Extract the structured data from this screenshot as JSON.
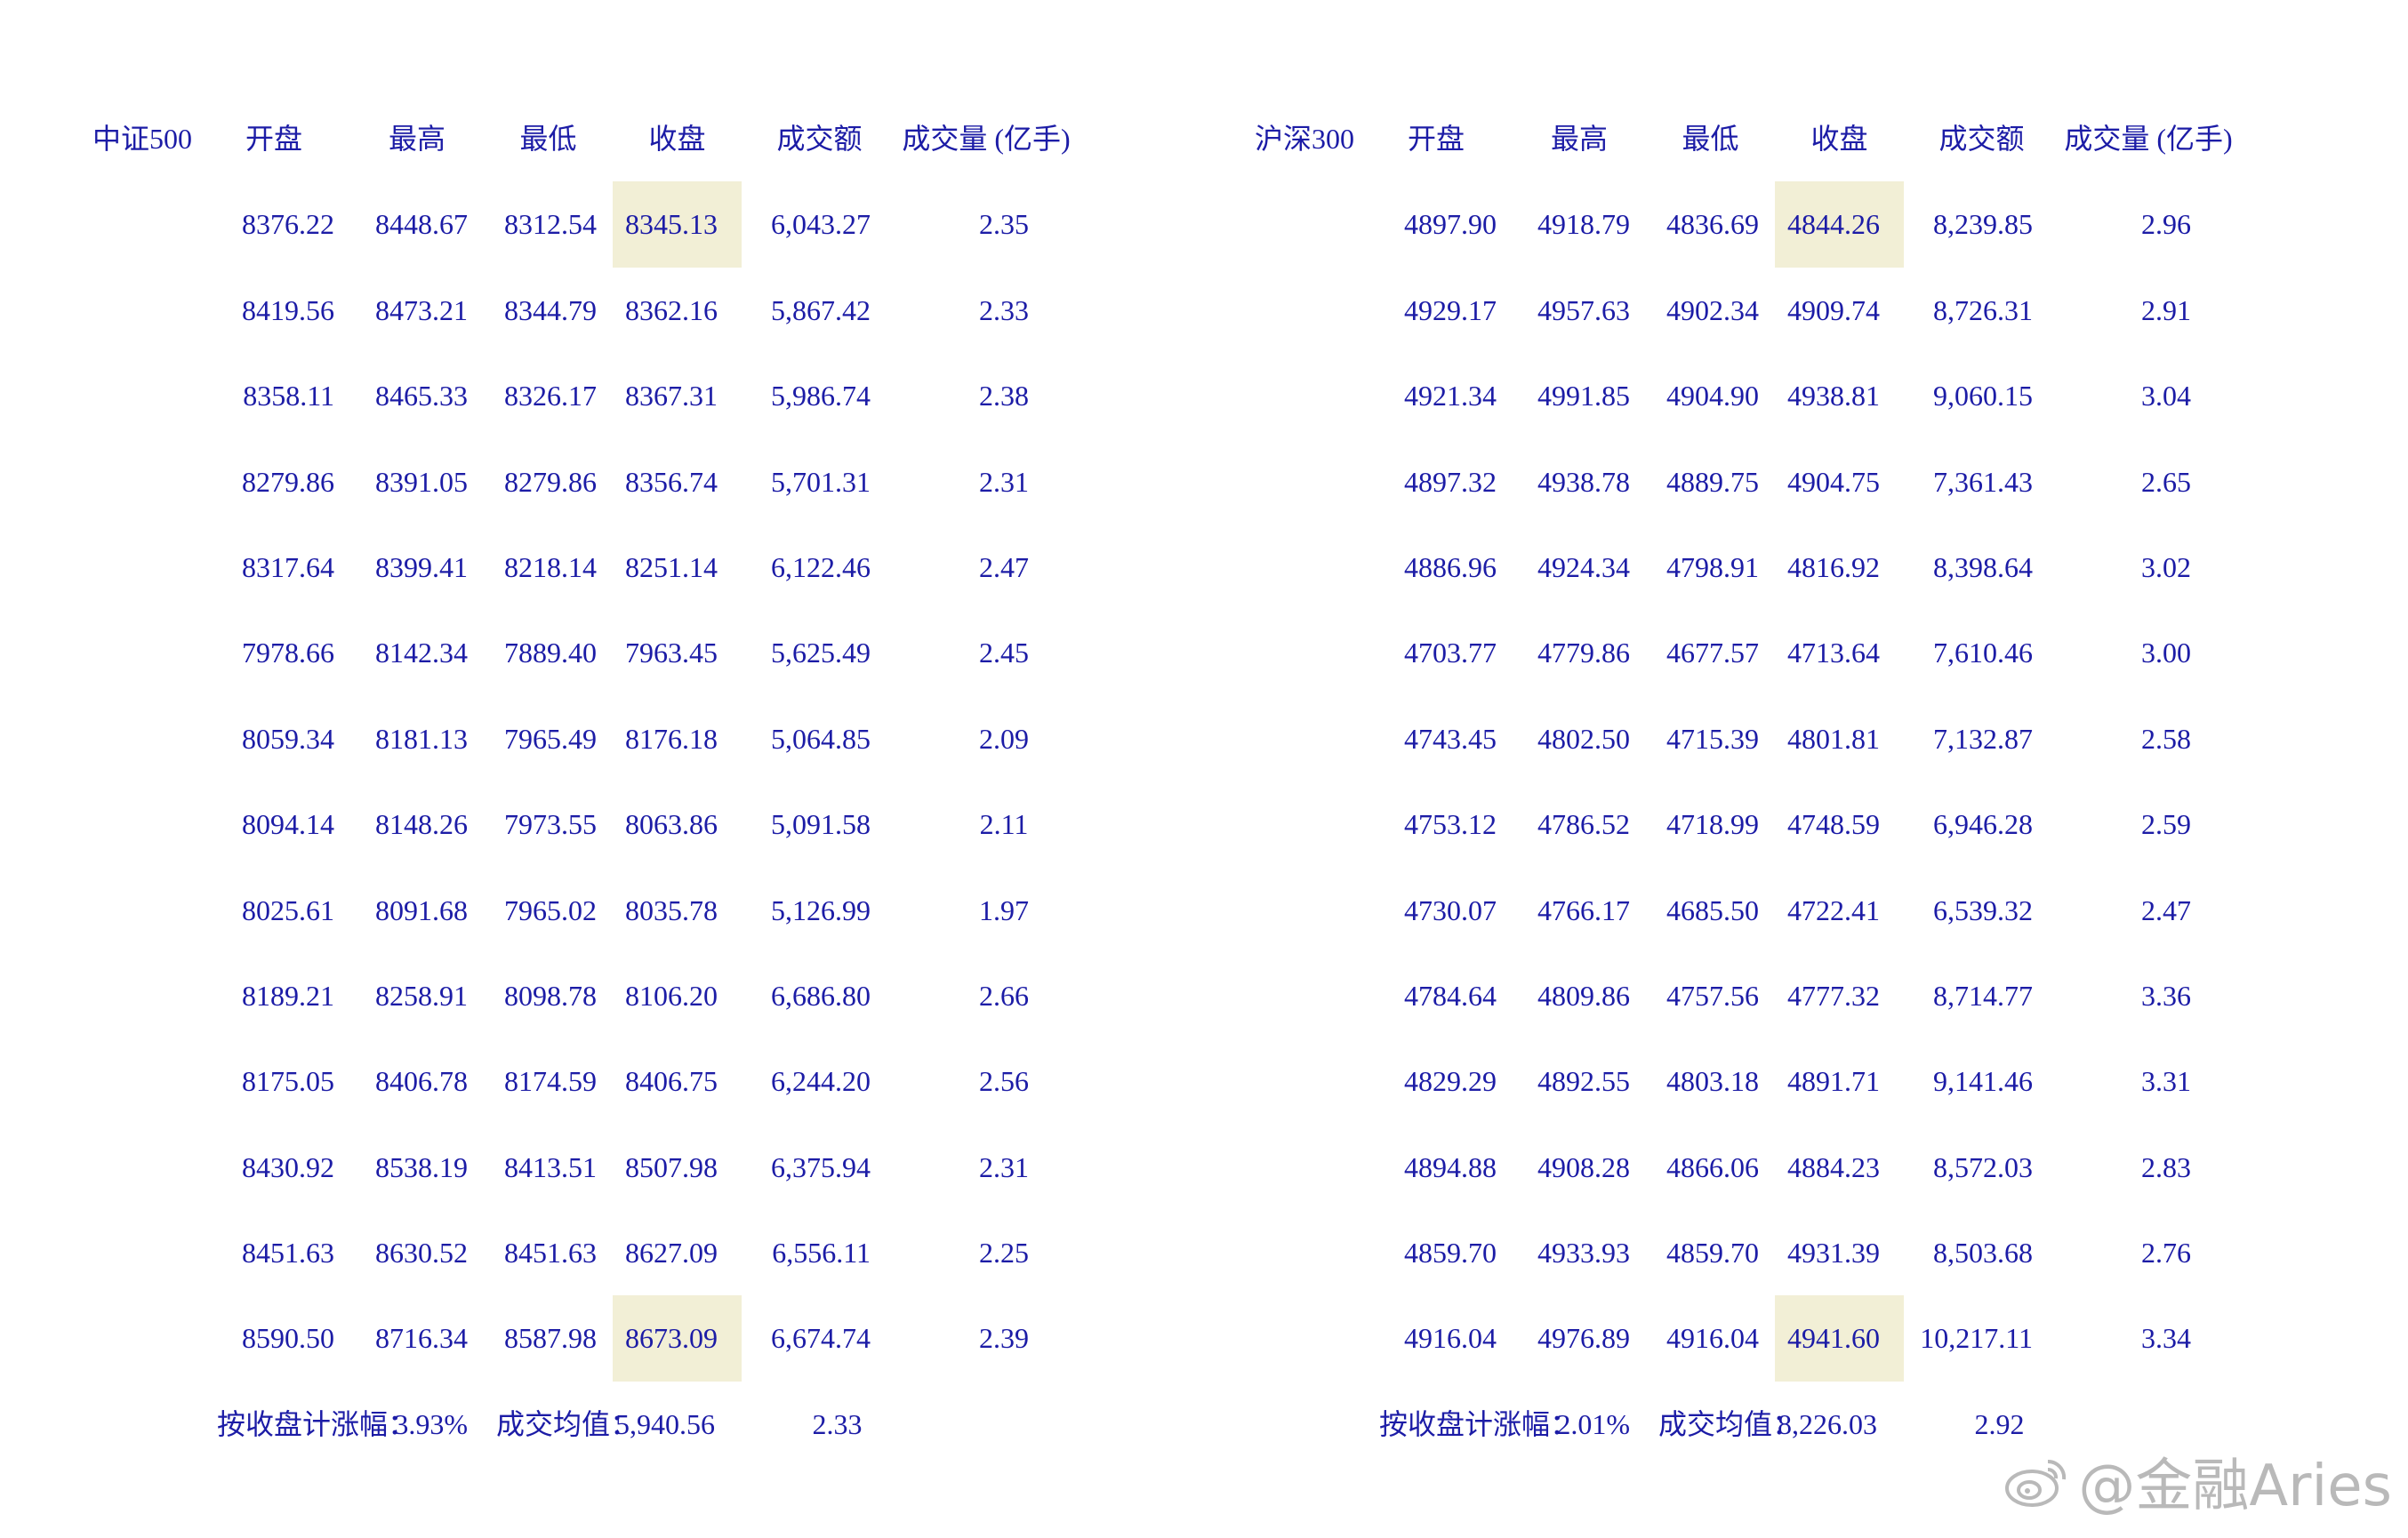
{
  "colors": {
    "text": "#1c1ca6",
    "highlight": "#f2efd6",
    "watermark": "#b9b9b9"
  },
  "headers": [
    "开盘",
    "最高",
    "最低",
    "收盘",
    "成交额",
    "成交量 (亿手)"
  ],
  "left": {
    "name": "中证500",
    "rows": [
      [
        "8376.22",
        "8448.67",
        "8312.54",
        "8345.13",
        "6,043.27",
        "2.35"
      ],
      [
        "8419.56",
        "8473.21",
        "8344.79",
        "8362.16",
        "5,867.42",
        "2.33"
      ],
      [
        "8358.11",
        "8465.33",
        "8326.17",
        "8367.31",
        "5,986.74",
        "2.38"
      ],
      [
        "8279.86",
        "8391.05",
        "8279.86",
        "8356.74",
        "5,701.31",
        "2.31"
      ],
      [
        "8317.64",
        "8399.41",
        "8218.14",
        "8251.14",
        "6,122.46",
        "2.47"
      ],
      [
        "7978.66",
        "8142.34",
        "7889.40",
        "7963.45",
        "5,625.49",
        "2.45"
      ],
      [
        "8059.34",
        "8181.13",
        "7965.49",
        "8176.18",
        "5,064.85",
        "2.09"
      ],
      [
        "8094.14",
        "8148.26",
        "7973.55",
        "8063.86",
        "5,091.58",
        "2.11"
      ],
      [
        "8025.61",
        "8091.68",
        "7965.02",
        "8035.78",
        "5,126.99",
        "1.97"
      ],
      [
        "8189.21",
        "8258.91",
        "8098.78",
        "8106.20",
        "6,686.80",
        "2.66"
      ],
      [
        "8175.05",
        "8406.78",
        "8174.59",
        "8406.75",
        "6,244.20",
        "2.56"
      ],
      [
        "8430.92",
        "8538.19",
        "8413.51",
        "8507.98",
        "6,375.94",
        "2.31"
      ],
      [
        "8451.63",
        "8630.52",
        "8451.63",
        "8627.09",
        "6,556.11",
        "2.25"
      ],
      [
        "8590.50",
        "8716.34",
        "8587.98",
        "8673.09",
        "6,674.74",
        "2.39"
      ]
    ],
    "summary": {
      "label": "按收盘计涨幅：",
      "pct": "3.93%",
      "avg_label": "成交均值：",
      "avg_amount": "5,940.56",
      "avg_volume": "2.33"
    }
  },
  "right": {
    "name": "沪深300",
    "rows": [
      [
        "4897.90",
        "4918.79",
        "4836.69",
        "4844.26",
        "8,239.85",
        "2.96"
      ],
      [
        "4929.17",
        "4957.63",
        "4902.34",
        "4909.74",
        "8,726.31",
        "2.91"
      ],
      [
        "4921.34",
        "4991.85",
        "4904.90",
        "4938.81",
        "9,060.15",
        "3.04"
      ],
      [
        "4897.32",
        "4938.78",
        "4889.75",
        "4904.75",
        "7,361.43",
        "2.65"
      ],
      [
        "4886.96",
        "4924.34",
        "4798.91",
        "4816.92",
        "8,398.64",
        "3.02"
      ],
      [
        "4703.77",
        "4779.86",
        "4677.57",
        "4713.64",
        "7,610.46",
        "3.00"
      ],
      [
        "4743.45",
        "4802.50",
        "4715.39",
        "4801.81",
        "7,132.87",
        "2.58"
      ],
      [
        "4753.12",
        "4786.52",
        "4718.99",
        "4748.59",
        "6,946.28",
        "2.59"
      ],
      [
        "4730.07",
        "4766.17",
        "4685.50",
        "4722.41",
        "6,539.32",
        "2.47"
      ],
      [
        "4784.64",
        "4809.86",
        "4757.56",
        "4777.32",
        "8,714.77",
        "3.36"
      ],
      [
        "4829.29",
        "4892.55",
        "4803.18",
        "4891.71",
        "9,141.46",
        "3.31"
      ],
      [
        "4894.88",
        "4908.28",
        "4866.06",
        "4884.23",
        "8,572.03",
        "2.83"
      ],
      [
        "4859.70",
        "4933.93",
        "4859.70",
        "4931.39",
        "8,503.68",
        "2.76"
      ],
      [
        "4916.04",
        "4976.89",
        "4916.04",
        "4941.60",
        "10,217.11",
        "3.34"
      ]
    ],
    "summary": {
      "label": "按收盘计涨幅：",
      "pct": "2.01%",
      "avg_label": "成交均值：",
      "avg_amount": "8,226.03",
      "avg_volume": "2.92"
    }
  },
  "watermark": {
    "text": "@金融Aries",
    "icon": "weibo-icon"
  }
}
